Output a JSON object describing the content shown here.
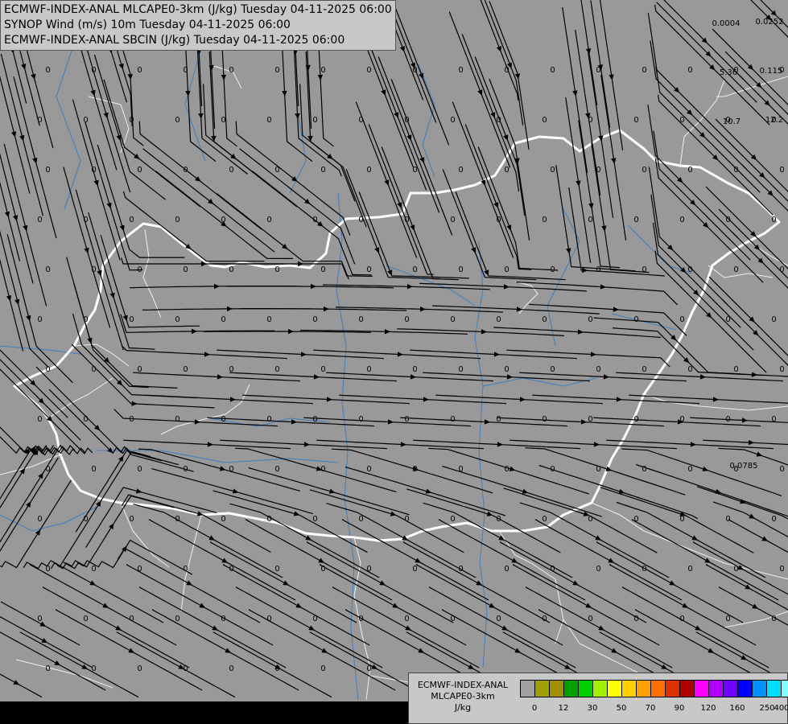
{
  "header": {
    "line1": "ECMWF-INDEX-ANAL MLCAPE0-3km (J/kg) Tuesday 04-11-2025 06:00",
    "line2": "SYNOP Wind (m/s) 10m Tuesday 04-11-2025 06:00",
    "line3": "ECMWF-INDEX-ANAL SBCIN (J/kg) Tuesday 04-11-2025 06:00"
  },
  "legend": {
    "title1": "ECMWF-INDEX-ANAL",
    "title2": "MLCAPE0-3km",
    "unit": "J/kg",
    "tick_labels": [
      "0",
      "12",
      "30",
      "50",
      "70",
      "90",
      "120",
      "160",
      "250",
      "400"
    ],
    "colors": [
      "#a0a0a0",
      "#a0a000",
      "#a09000",
      "#00a000",
      "#00d000",
      "#a0f000",
      "#ffff00",
      "#ffd000",
      "#ffa000",
      "#ff7000",
      "#e03000",
      "#b00000",
      "#ff00ff",
      "#b000ff",
      "#7000ff",
      "#0000ff",
      "#0090ff",
      "#00e0ff",
      "#80ffff",
      "#ffffff"
    ]
  },
  "field_values": [
    "0",
    "0.0004",
    "0.0252",
    "0.115",
    "5.36",
    "10.7",
    "12.2",
    "0.0785"
  ],
  "colors": {
    "background": "#999999",
    "border": "#ffffff",
    "river": "#3d7fc0",
    "streamline": "#000000"
  }
}
